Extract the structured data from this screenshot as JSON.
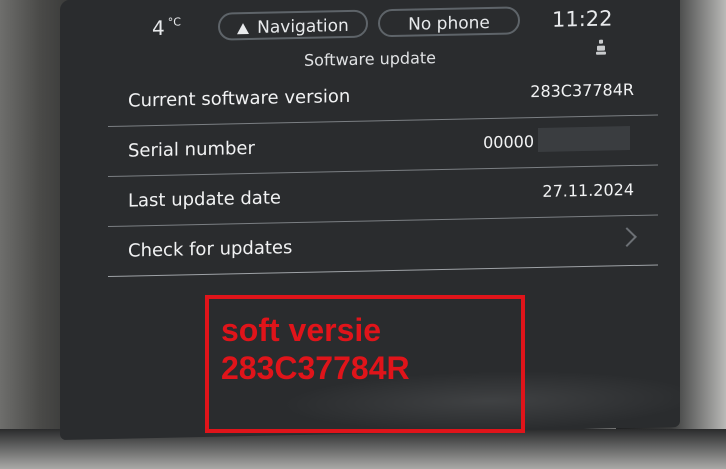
{
  "status_bar": {
    "temperature": "4",
    "temperature_unit": "°C",
    "nav_label": "Navigation",
    "phone_label": "No phone",
    "time": "11:22"
  },
  "page": {
    "title": "Software update",
    "icon": "car-icon"
  },
  "rows": [
    {
      "label": "Current software version",
      "value": "283C37784R"
    },
    {
      "label": "Serial number",
      "value": "00000"
    },
    {
      "label": "Last update date",
      "value": "27.11.2024"
    },
    {
      "label": "Check for updates",
      "value": ""
    }
  ],
  "annotation": {
    "line1": "soft versie",
    "line2": "283C37784R",
    "color": "#e0141a"
  },
  "colors": {
    "screen_bg": "#2a2c2e",
    "text": "#f1f2f3",
    "divider": "#7b7f83"
  }
}
